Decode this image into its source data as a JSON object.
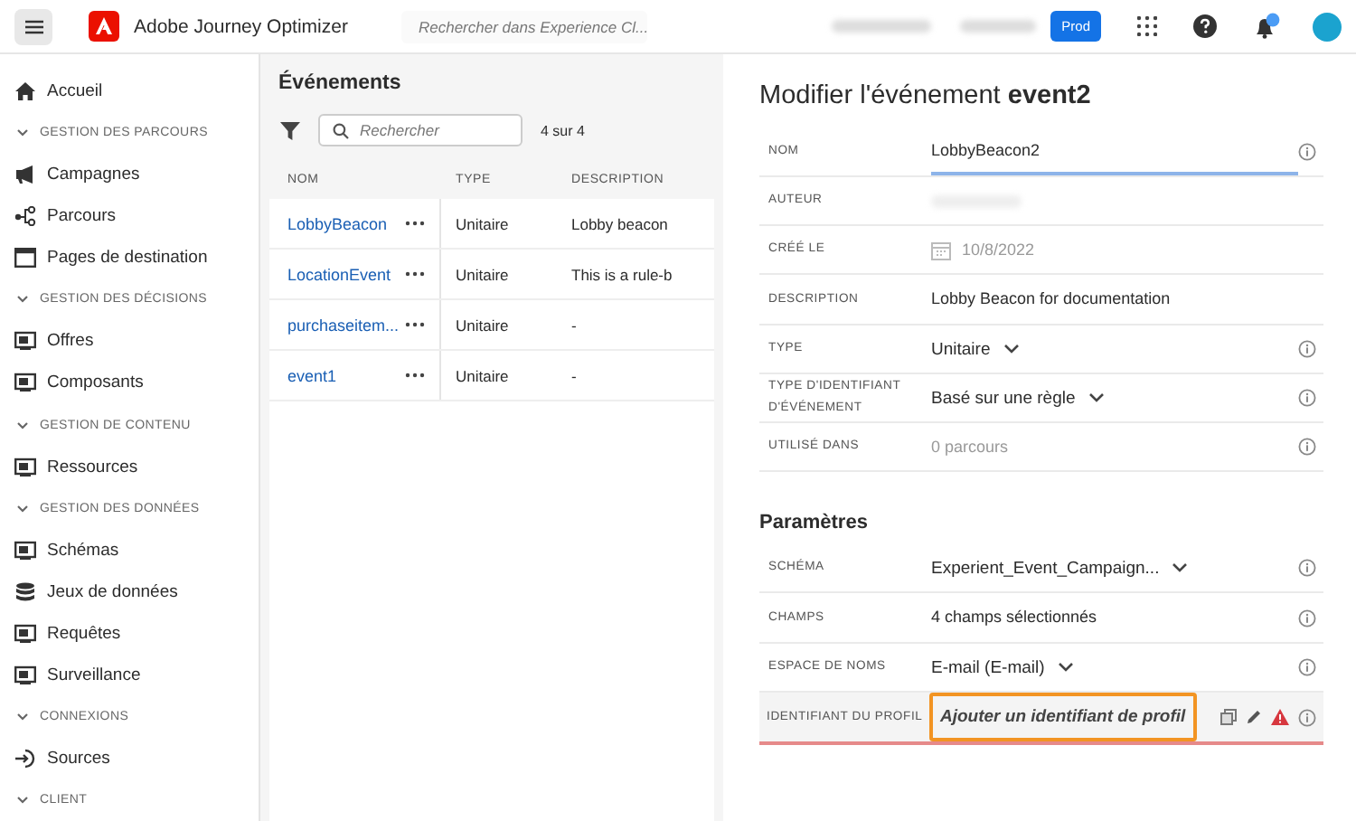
{
  "header": {
    "app_name": "Adobe Journey Optimizer",
    "search_placeholder": "Rechercher dans Experience Cl...",
    "sandbox_badge": "Prod",
    "has_notification": true
  },
  "sidebar": {
    "items": [
      {
        "kind": "item",
        "label": "Accueil"
      },
      {
        "kind": "section",
        "label": "GESTION DES PARCOURS",
        "expanded": true
      },
      {
        "kind": "item",
        "label": "Campagnes"
      },
      {
        "kind": "item",
        "label": "Parcours"
      },
      {
        "kind": "item",
        "label": "Pages de destination"
      },
      {
        "kind": "section",
        "label": "GESTION DES DÉCISIONS",
        "expanded": true
      },
      {
        "kind": "item",
        "label": "Offres"
      },
      {
        "kind": "item",
        "label": "Composants"
      },
      {
        "kind": "section",
        "label": "GESTION DE CONTENU",
        "expanded": true
      },
      {
        "kind": "item",
        "label": "Ressources"
      },
      {
        "kind": "section",
        "label": "GESTION DES DONNÉES",
        "expanded": true
      },
      {
        "kind": "item",
        "label": "Schémas"
      },
      {
        "kind": "item",
        "label": "Jeux de données"
      },
      {
        "kind": "item",
        "label": "Requêtes"
      },
      {
        "kind": "item",
        "label": "Surveillance"
      },
      {
        "kind": "section",
        "label": "CONNEXIONS",
        "expanded": true
      },
      {
        "kind": "item",
        "label": "Sources"
      },
      {
        "kind": "section",
        "label": "CLIENT",
        "expanded": true
      }
    ]
  },
  "events": {
    "title": "Événements",
    "search_placeholder": "Rechercher",
    "count": "4 sur 4",
    "columns": [
      "NOM",
      "TYPE",
      "DESCRIPTION"
    ],
    "rows": [
      {
        "name": "LobbyBeacon",
        "type": "Unitaire",
        "description": "Lobby beacon"
      },
      {
        "name": "LocationEvent",
        "type": "Unitaire",
        "description": "This is a rule-b"
      },
      {
        "name": "purchaseitem...",
        "type": "Unitaire",
        "description": "-"
      },
      {
        "name": "event1",
        "type": "Unitaire",
        "description": "-"
      }
    ]
  },
  "editor": {
    "title": "Modifier l'événement **event2**",
    "fields": [
      {
        "label": "NOM",
        "kind": "text",
        "value": "LobbyBeacon2",
        "focused": true,
        "info": true
      },
      {
        "label": "AUTEUR",
        "kind": "redacted",
        "info": false
      },
      {
        "label": "CRÉÉ LE",
        "kind": "date",
        "value": "10/8/2022",
        "info": false
      },
      {
        "label": "DESCRIPTION",
        "kind": "text",
        "value": "Lobby Beacon for documentation",
        "focused": false,
        "info": false
      },
      {
        "label": "TYPE",
        "kind": "select",
        "value": "Unitaire",
        "info": true
      },
      {
        "label": "TYPE D'IDENTIFIANT D'ÉVÉNEMENT",
        "kind": "select",
        "value": "Basé sur une règle",
        "info": true
      },
      {
        "label": "UTILISÉ DANS",
        "kind": "readonly",
        "value": "0 parcours",
        "info": true
      }
    ],
    "section_title": "Paramètres",
    "params": [
      {
        "label": "SCHÉMA",
        "kind": "select",
        "value": "Experient_Event_Campaign...",
        "info": true
      },
      {
        "label": "CHAMPS",
        "kind": "text",
        "value": "4 champs sélectionnés",
        "focused": false,
        "info": true
      },
      {
        "label": "ESPACE DE NOMS",
        "kind": "select",
        "value": "E-mail (E-mail)",
        "info": true
      },
      {
        "label": "IDENTIFIANT DU PROFIL",
        "kind": "profile",
        "placeholder": "Ajouter un identifiant de profil",
        "error": true,
        "highlighted": true,
        "info": true
      }
    ]
  }
}
